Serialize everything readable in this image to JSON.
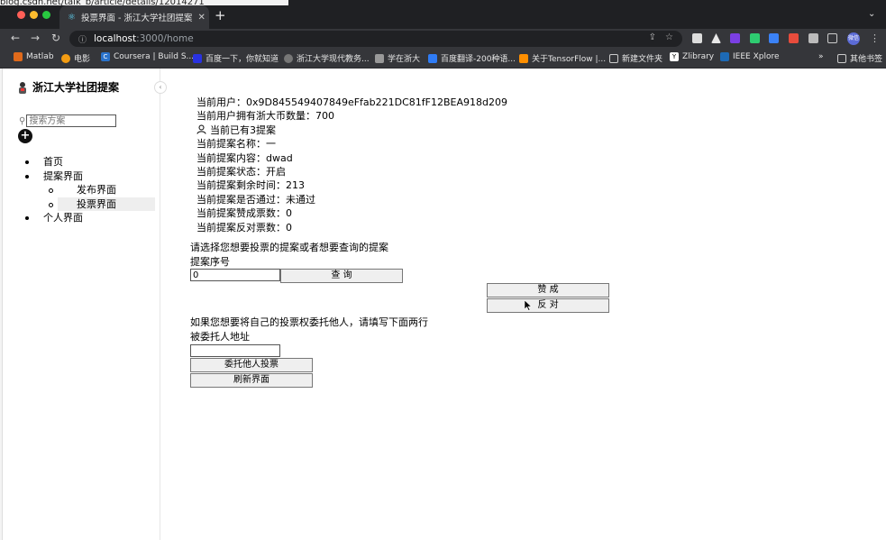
{
  "browser": {
    "background_url_fragment": "blog.csdn.net/talk_b/article/details/12014271",
    "tab_title": "投票界面 - 浙江大学社团提案",
    "tab_close": "✕",
    "new_tab": "+",
    "url_host": "localhost",
    "url_path": ":3000/home",
    "bookmarks": [
      "Matlab",
      "电影",
      "Coursera | Build S...",
      "百度一下，你就知道",
      "浙江大学现代教务...",
      "学在浙大",
      "百度翻译-200种语...",
      "关于TensorFlow |...",
      "新建文件夹",
      "Zlibrary",
      "IEEE Xplore"
    ],
    "bookmarks_more": "»",
    "other_bookmarks": "其他书签",
    "profile_label": "微信",
    "colors": {
      "close": "#ff5f57",
      "minimize": "#febc2e",
      "maximize": "#28c840",
      "tab_bar": "#1f2023",
      "toolbar": "#35363a"
    }
  },
  "sidebar": {
    "brand": "浙江大学社团提案",
    "collapse_icon": "‹",
    "search_placeholder": "搜索方案",
    "add_icon": "+",
    "menu": [
      {
        "label": "首页",
        "level": 1
      },
      {
        "label": "提案界面",
        "level": 1
      },
      {
        "label": "发布界面",
        "level": 2
      },
      {
        "label": "投票界面",
        "level": 2,
        "selected": true
      },
      {
        "label": "个人界面",
        "level": 1
      }
    ]
  },
  "main": {
    "current_user": "当前用户：0x9D845549407849eFfab221DC81fF12BEA918d209",
    "balance": "当前用户拥有浙大币数量：700",
    "proposal_count": "当前已有3提案",
    "name": "当前提案名称：一",
    "content": "当前提案内容：dwad",
    "status": "当前提案状态：开启",
    "time_left": "当前提案剩余时间：213",
    "passed": "当前提案是否通过：未通过",
    "yes_votes": "当前提案赞成票数：0",
    "no_votes": "当前提案反对票数：0",
    "select_prompt": "请选择您想要投票的提案或者想要查询的提案",
    "id_label": "提案序号",
    "id_value": "0",
    "query_button": "查 询",
    "approve_button": "赞 成",
    "oppose_button": "反 对",
    "delegate_prompt": "如果您想要将自己的投票权委托他人，请填写下面两行",
    "delegate_label": "被委托人地址",
    "delegate_value": "",
    "delegate_button": "委托他人投票",
    "refresh_button": "刷新界面"
  }
}
